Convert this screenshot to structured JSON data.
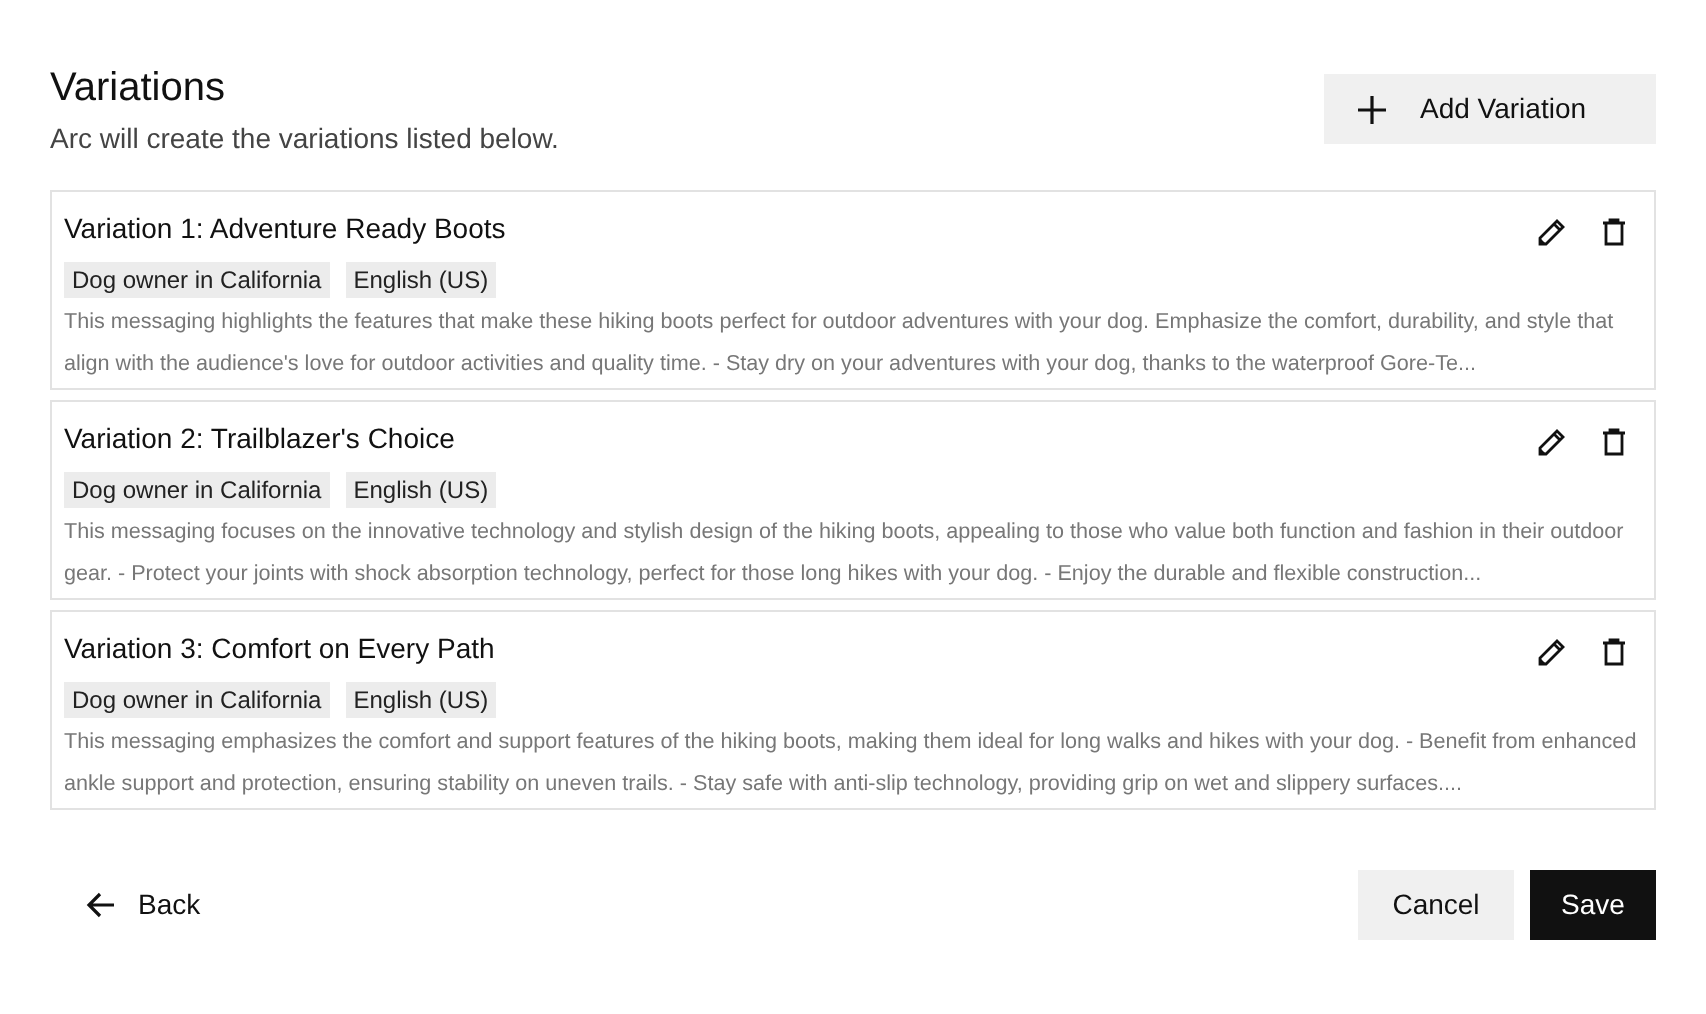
{
  "header": {
    "title": "Variations",
    "subtitle": "Arc will create the variations listed below.",
    "add_button": "Add Variation"
  },
  "variations": [
    {
      "title": "Variation 1: Adventure Ready Boots",
      "tags": [
        "Dog owner in California",
        "English (US)"
      ],
      "description": "This messaging highlights the features that make these hiking boots perfect for outdoor adventures with your dog. Emphasize the comfort, durability, and style that align with the audience's love for outdoor activities and quality time. - Stay dry on your adventures with your dog, thanks to the waterproof Gore-Te..."
    },
    {
      "title": "Variation 2: Trailblazer's Choice",
      "tags": [
        "Dog owner in California",
        "English (US)"
      ],
      "description": "This messaging focuses on the innovative technology and stylish design of the hiking boots, appealing to those who value both function and fashion in their outdoor gear. - Protect your joints with shock absorption technology, perfect for those long hikes with your dog. - Enjoy the durable and flexible construction..."
    },
    {
      "title": "Variation 3: Comfort on Every Path",
      "tags": [
        "Dog owner in California",
        "English (US)"
      ],
      "description": "This messaging emphasizes the comfort and support features of the hiking boots, making them ideal for long walks and hikes with your dog. - Benefit from enhanced ankle support and protection, ensuring stability on uneven trails. - Stay safe with anti-slip technology, providing grip on wet and slippery surfaces...."
    }
  ],
  "footer": {
    "back": "Back",
    "cancel": "Cancel",
    "save": "Save"
  }
}
